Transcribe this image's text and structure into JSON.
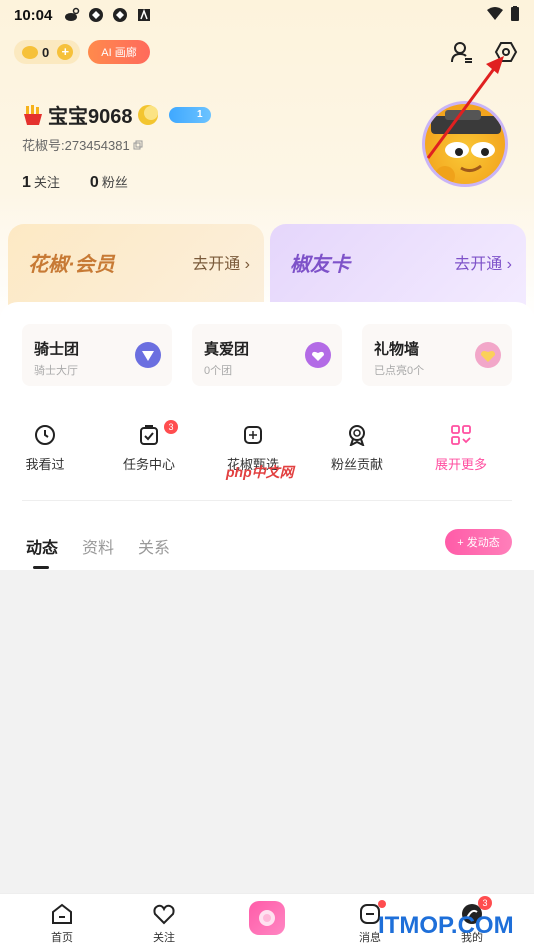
{
  "status_bar": {
    "time": "10:04"
  },
  "header": {
    "coin_count": "0",
    "coin_plus": "+",
    "ai_label": "AI 画廊"
  },
  "profile": {
    "username": "宝宝9068",
    "level": "1",
    "id_text": "花椒号:273454381",
    "following_count": "1",
    "following_label": "关注",
    "fans_count": "0",
    "fans_label": "粉丝"
  },
  "cards": {
    "vip_title": "花椒·会员",
    "vip_action": "去开通 ›",
    "jyk_title": "椒友卡",
    "jyk_action": "去开通 ›"
  },
  "features": [
    {
      "title": "骑士团",
      "subtitle": "骑士大厅",
      "color": "#6b6fe0"
    },
    {
      "title": "真爱团",
      "subtitle": "0个团",
      "color": "#b36be6"
    },
    {
      "title": "礼物墙",
      "subtitle": "已点亮0个",
      "color": "#f08ac0"
    }
  ],
  "shortcuts": [
    {
      "label": "我看过",
      "icon": "clock-icon"
    },
    {
      "label": "任务中心",
      "icon": "task-icon",
      "badge": "3"
    },
    {
      "label": "花椒甄选",
      "icon": "select-icon"
    },
    {
      "label": "粉丝贡献",
      "icon": "medal-icon"
    },
    {
      "label": "展开更多",
      "icon": "grid-icon"
    }
  ],
  "tabs": [
    "动态",
    "资料",
    "关系"
  ],
  "post_button": "+ 发动态",
  "bottom_nav": [
    {
      "label": "首页",
      "icon": "home-icon"
    },
    {
      "label": "关注",
      "icon": "heart-icon"
    },
    {
      "label": "",
      "icon": "live-icon"
    },
    {
      "label": "消息",
      "icon": "message-icon"
    },
    {
      "label": "我的",
      "icon": "me-icon",
      "badge": "3"
    }
  ],
  "watermarks": {
    "php": "php中文网",
    "itmop": "ITMOP.COM"
  },
  "colors": {
    "accent_pink": "#ff5ca8",
    "gold": "#f6c13a",
    "badge_red": "#ff4d4f"
  }
}
